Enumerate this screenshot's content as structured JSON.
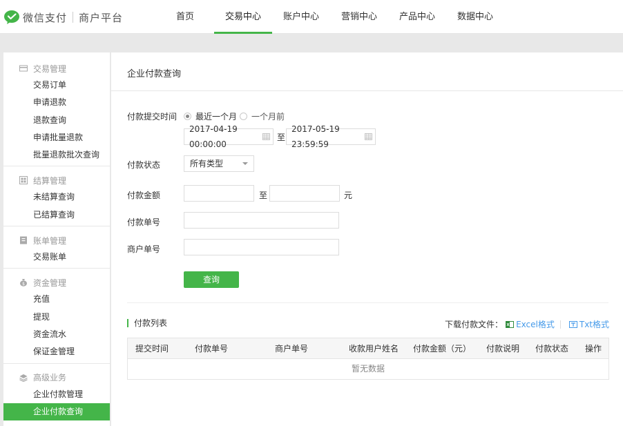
{
  "header": {
    "brand_name": "微信支付",
    "brand_sub": "商户平台",
    "nav": [
      "首页",
      "交易中心",
      "账户中心",
      "营销中心",
      "产品中心",
      "数据中心"
    ],
    "active_nav": "交易中心"
  },
  "sidebar": {
    "groups": [
      {
        "title": "交易管理",
        "icon": "card-icon",
        "items": [
          "交易订单",
          "申请退款",
          "退款查询",
          "申请批量退款",
          "批量退款批次查询"
        ]
      },
      {
        "title": "结算管理",
        "icon": "grid-icon",
        "items": [
          "未结算查询",
          "已结算查询"
        ]
      },
      {
        "title": "账单管理",
        "icon": "bill-icon",
        "items": [
          "交易账单"
        ]
      },
      {
        "title": "资金管理",
        "icon": "money-bag-icon",
        "items": [
          "充值",
          "提现",
          "资金流水",
          "保证金管理"
        ]
      },
      {
        "title": "高级业务",
        "icon": "layers-icon",
        "items": [
          "企业付款管理",
          "企业付款查询"
        ]
      }
    ],
    "active_item": "企业付款查询"
  },
  "main": {
    "page_title": "企业付款查询",
    "form": {
      "time_label": "付款提交时间",
      "radio_recent": "最近一个月",
      "radio_before": "一个月前",
      "start_date": "2017-04-19 00:00:00",
      "date_sep": "至",
      "end_date": "2017-05-19 23:59:59",
      "status_label": "付款状态",
      "status_value": "所有类型",
      "amount_label": "付款金额",
      "amount_sep": "至",
      "amount_unit": "元",
      "pay_no_label": "付款单号",
      "merchant_no_label": "商户单号",
      "query_button": "查询"
    },
    "list": {
      "title": "付款列表",
      "download_label": "下载付款文件：",
      "excel_link": "Excel格式",
      "txt_link": "Txt格式",
      "columns": [
        "提交时间",
        "付款单号",
        "商户单号",
        "收款用户姓名",
        "付款金额（元）",
        "付款说明",
        "付款状态",
        "操作"
      ],
      "empty_text": "暂无数据"
    }
  },
  "colors": {
    "accent": "#44b549",
    "link": "#459ae9"
  }
}
